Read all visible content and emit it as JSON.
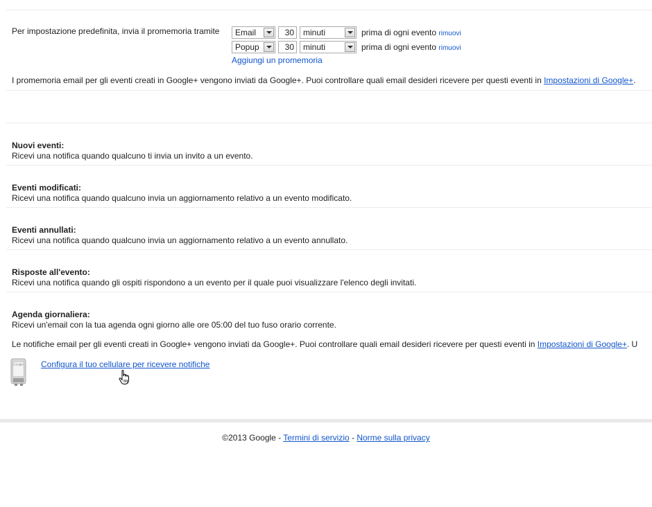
{
  "reminders": {
    "intro": "Per impostazione predefinita, invia il promemoria tramite",
    "rows": [
      {
        "method": "Email",
        "amount": "30",
        "unit": "minuti",
        "suffix": "prima di ogni evento",
        "remove": "rimuovi"
      },
      {
        "method": "Popup",
        "amount": "30",
        "unit": "minuti",
        "suffix": "prima di ogni evento",
        "remove": "rimuovi"
      }
    ],
    "add_link": "Aggiungi un promemoria",
    "gplus_note": "I promemoria email per gli eventi creati in Google+ vengono inviati da Google+. Puoi controllare quali email desideri ricevere per questi eventi in",
    "gplus_link": "Impostazioni di Google+",
    "gplus_tail": "."
  },
  "notifications": [
    {
      "title": "Nuovi eventi:",
      "desc": "Ricevi una notifica quando qualcuno ti invia un invito a un evento."
    },
    {
      "title": "Eventi modificati:",
      "desc": "Ricevi una notifica quando qualcuno invia un aggiornamento relativo a un evento modificato."
    },
    {
      "title": "Eventi annullati:",
      "desc": "Ricevi una notifica quando qualcuno invia un aggiornamento relativo a un evento annullato."
    },
    {
      "title": "Risposte all'evento:",
      "desc": "Ricevi una notifica quando gli ospiti rispondono a un evento per il quale puoi visualizzare l'elenco degli invitati."
    },
    {
      "title": "Agenda giornaliera:",
      "desc": "Ricevi un'email con la tua agenda ogni giorno alle ore 05:00 del tuo fuso orario corrente."
    }
  ],
  "notif_note": {
    "text": "Le notifiche email per gli eventi creati in Google+ vengono inviati da Google+. Puoi controllare quali email desideri ricevere per questi eventi in",
    "link": "Impostazioni di Google+",
    "tail": ". U"
  },
  "mobile": {
    "link": "Configura il tuo cellulare per ricevere notifiche",
    "phone_brand": "Google"
  },
  "footer": {
    "copyright": "©2013 Google -",
    "terms": "Termini di servizio",
    "sep": "-",
    "privacy": "Norme sulla privacy"
  }
}
